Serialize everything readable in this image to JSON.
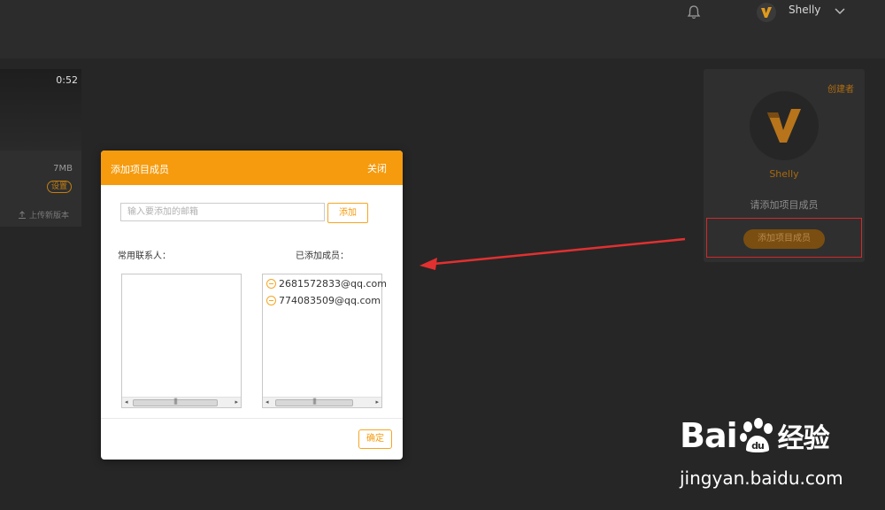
{
  "topbar": {
    "username": "Shelly",
    "icons": [
      "bell-icon",
      "user-avatar-icon",
      "chevron-down-icon"
    ]
  },
  "video_card": {
    "duration": "0:52",
    "size": "7MB",
    "setting_badge": "设置",
    "upload_label": "上传新版本"
  },
  "right_panel": {
    "creator_label": "创建者",
    "name": "Shelly",
    "hint": "请添加项目成员",
    "add_button": "添加项目成员"
  },
  "modal": {
    "title": "添加项目成员",
    "close_label": "关闭",
    "email_placeholder": "输入要添加的邮箱",
    "add_button": "添加",
    "contacts_label": "常用联系人：",
    "added_label": "已添加成员：",
    "contacts": [],
    "members": [
      "2681572833@qq.com",
      "774083509@qq.com"
    ],
    "confirm_button": "确定"
  },
  "watermark": {
    "logo_left": "Bai",
    "logo_mid": "du",
    "logo_right": "经验",
    "url": "jingyan.baidu.com"
  },
  "colors": {
    "accent": "#f59b0d",
    "background": "#262626",
    "annotation": "#d02a2a"
  }
}
